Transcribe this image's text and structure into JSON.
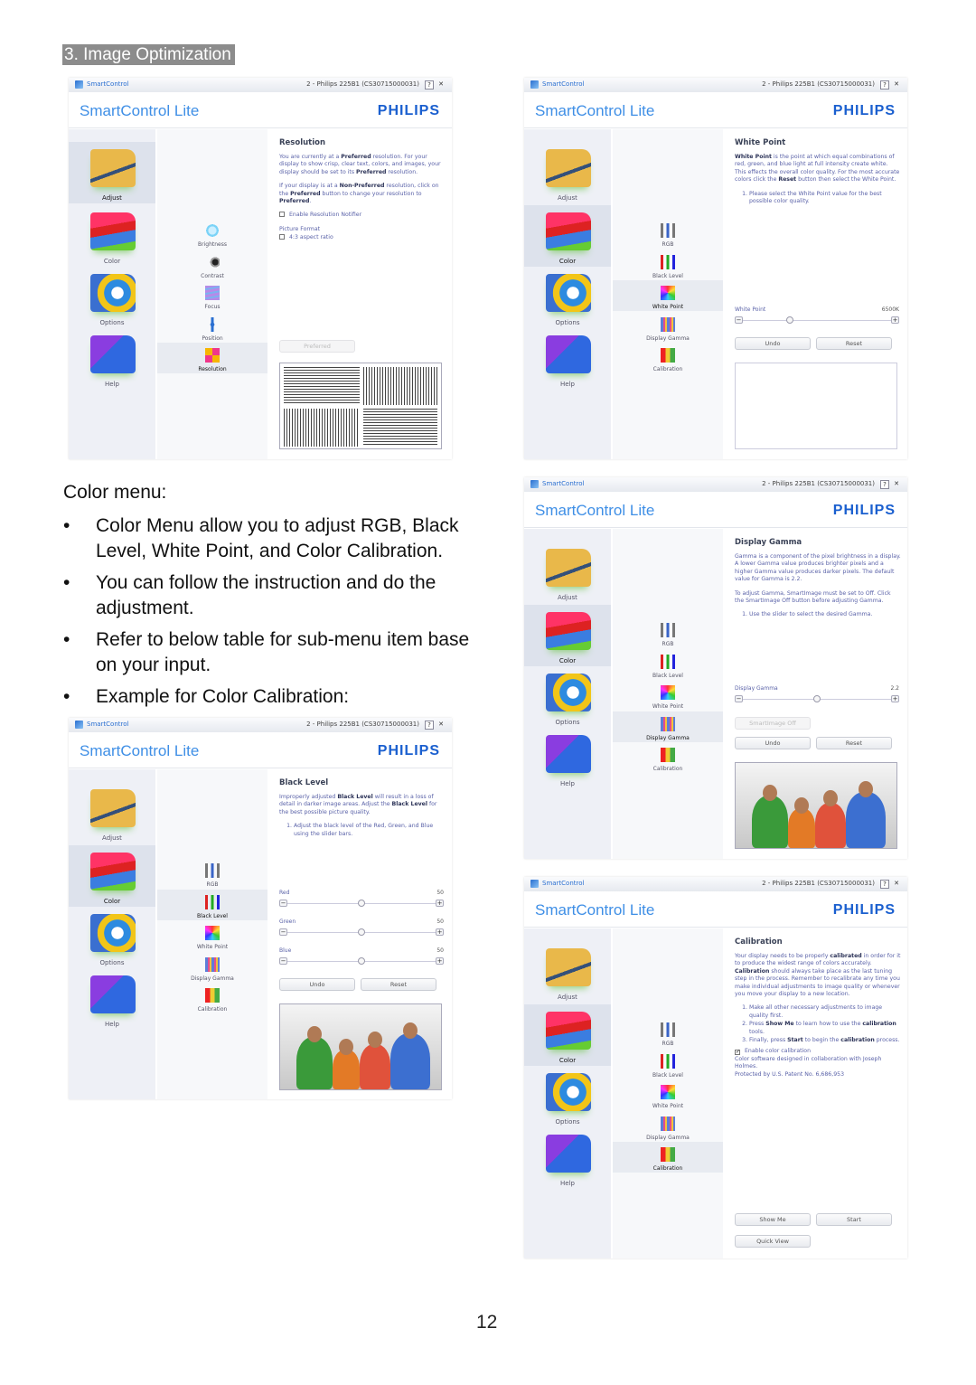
{
  "section_title": "3. Image Optimization",
  "color_menu_heading": "Color menu:",
  "bullets": [
    "Color Menu allow you to adjust RGB, Black Level, White Point, and Color Calibration.",
    "You can follow the instruction and do the adjustment.",
    "Refer to below table for sub-menu item base on your input.",
    "Example for Color Calibration:"
  ],
  "bullet_glyph": "•",
  "page_number": "12",
  "app": {
    "titlebar_app": "SmartControl",
    "monitor": "2 - Philips 225B1 (CS30715000031)",
    "help_btn": "?",
    "close_btn": "✕",
    "title": "SmartControl Lite",
    "brand": "PHILIPS",
    "brand_color": "#1a5fcf",
    "title_color": "#3f8fe6",
    "main_nav": [
      "Adjust",
      "Color",
      "Options",
      "Help"
    ],
    "adjust_sub": [
      "Brightness",
      "Contrast",
      "Focus",
      "Position",
      "Resolution"
    ],
    "color_sub": [
      "RGB",
      "Black Level",
      "White Point",
      "Display Gamma",
      "Calibration"
    ]
  },
  "panels": [
    {
      "id": "resolution",
      "main_selected": "Adjust",
      "sub_menu": "adjust_sub",
      "sub_selected": "Resolution",
      "title": "Resolution",
      "paragraphs": [
        [
          "You are currently at a ",
          "Preferred",
          " resolution. For your display to show crisp, clear text, colors, and images, your display should be set to its ",
          "Preferred",
          " resolution."
        ],
        [
          "If your display is at a ",
          "Non-Preferred",
          " resolution, click on the ",
          "Preferred",
          " button to change your resolution to ",
          "Preferred",
          "."
        ]
      ],
      "checkbox": {
        "label": "Enable Resolution Notifier",
        "checked": false
      },
      "picture_format_label": "Picture Format",
      "checkbox2": {
        "label": "4:3 aspect ratio",
        "checked": false
      },
      "preferred_button": "Preferred"
    },
    {
      "id": "white-point",
      "main_selected": "Color",
      "sub_menu": "color_sub",
      "sub_selected": "White Point",
      "title": "White Point",
      "paragraphs": [
        [
          "",
          "White Point",
          " is the point at which equal combinations of red, green, and blue light at full intensity create white. This effects the overall color quality. For the most accurate colors click the ",
          "Reset",
          " button then select the White Point."
        ]
      ],
      "steps": [
        "Please select the White Point value for the best possible color quality."
      ],
      "sliders": [
        {
          "label": "White Point",
          "value": "6500K",
          "level": 0.32
        }
      ],
      "undo": "Undo",
      "reset": "Reset"
    },
    {
      "id": "display-gamma",
      "main_selected": "Color",
      "sub_menu": "color_sub",
      "sub_selected": "Display Gamma",
      "title": "Display Gamma",
      "paragraphs": [
        [
          "Gamma is a component of the pixel brightness in a display. A lower Gamma value produces brighter pixels and a higher Gamma value produces darker pixels. The default value for Gamma is 2.2."
        ],
        [
          "To adjust Gamma, SmartImage must be set to Off. Click the SmartImage Off button before adjusting Gamma."
        ]
      ],
      "steps": [
        "Use the slider to select the desired Gamma."
      ],
      "sliders": [
        {
          "label": "Display Gamma",
          "value": "2.2",
          "level": 0.5
        }
      ],
      "smartimage_off": "SmartImage Off",
      "undo": "Undo",
      "reset": "Reset"
    },
    {
      "id": "black-level",
      "main_selected": "Color",
      "sub_menu": "color_sub",
      "sub_selected": "Black Level",
      "title": "Black Level",
      "paragraphs": [
        [
          "Improperly adjusted ",
          "Black Level",
          " will result in a loss of detail in darker image areas. Adjust the ",
          "Black Level",
          " for the best possible picture quality."
        ]
      ],
      "steps": [
        "Adjust the black level of the Red, Green, and Blue using the slider bars."
      ],
      "sliders": [
        {
          "label": "Red",
          "value": "50",
          "level": 0.5
        },
        {
          "label": "Green",
          "value": "50",
          "level": 0.5
        },
        {
          "label": "Blue",
          "value": "50",
          "level": 0.5
        }
      ],
      "undo": "Undo",
      "reset": "Reset"
    },
    {
      "id": "calibration",
      "main_selected": "Color",
      "sub_menu": "color_sub",
      "sub_selected": "Calibration",
      "title": "Calibration",
      "paragraphs": [
        [
          "Your display needs to be properly ",
          "calibrated",
          " in order for it to produce the widest range of colors accurately. ",
          "Calibration",
          " should always take place as the last tuning step in the process. Remember to recalibrate any time you make individual adjustments to image quality or whenever you move your display to a new location."
        ]
      ],
      "steps": [
        [
          "Make all other necessary adjustments to image quality first."
        ],
        [
          "Press ",
          "Show Me",
          " to learn how to use the ",
          "calibration",
          " tools."
        ],
        [
          "Finally, press ",
          "Start",
          " to begin the ",
          "calibration",
          " process."
        ]
      ],
      "checkbox": {
        "label": "Enable color calibration",
        "checked": true
      },
      "credits": [
        "Color software designed in collaboration with Joseph Holmes.",
        "Protected by U.S. Patent No. 6,686,953"
      ],
      "show_me": "Show Me",
      "start": "Start",
      "quick_view": "Quick View"
    }
  ]
}
